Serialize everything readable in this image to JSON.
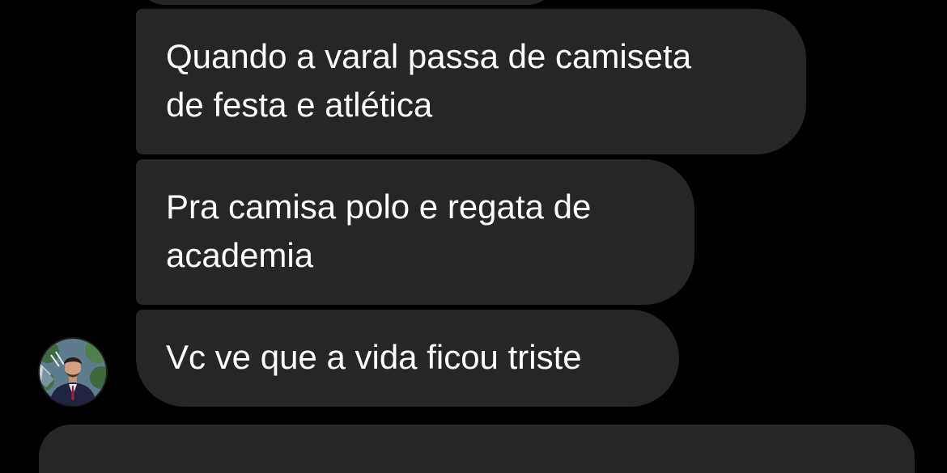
{
  "messages": [
    {
      "lines": [
        "Quando a varal passa de camiseta",
        "de festa e atlética"
      ]
    },
    {
      "lines": [
        "Pra camisa polo e regata de",
        "academia"
      ]
    },
    {
      "lines": [
        "Vc ve que a vida ficou triste"
      ]
    }
  ],
  "colors": {
    "background": "#000000",
    "bubble": "#262626",
    "text": "#ffffff"
  },
  "icons": {
    "avatar": "sender-profile-photo"
  }
}
